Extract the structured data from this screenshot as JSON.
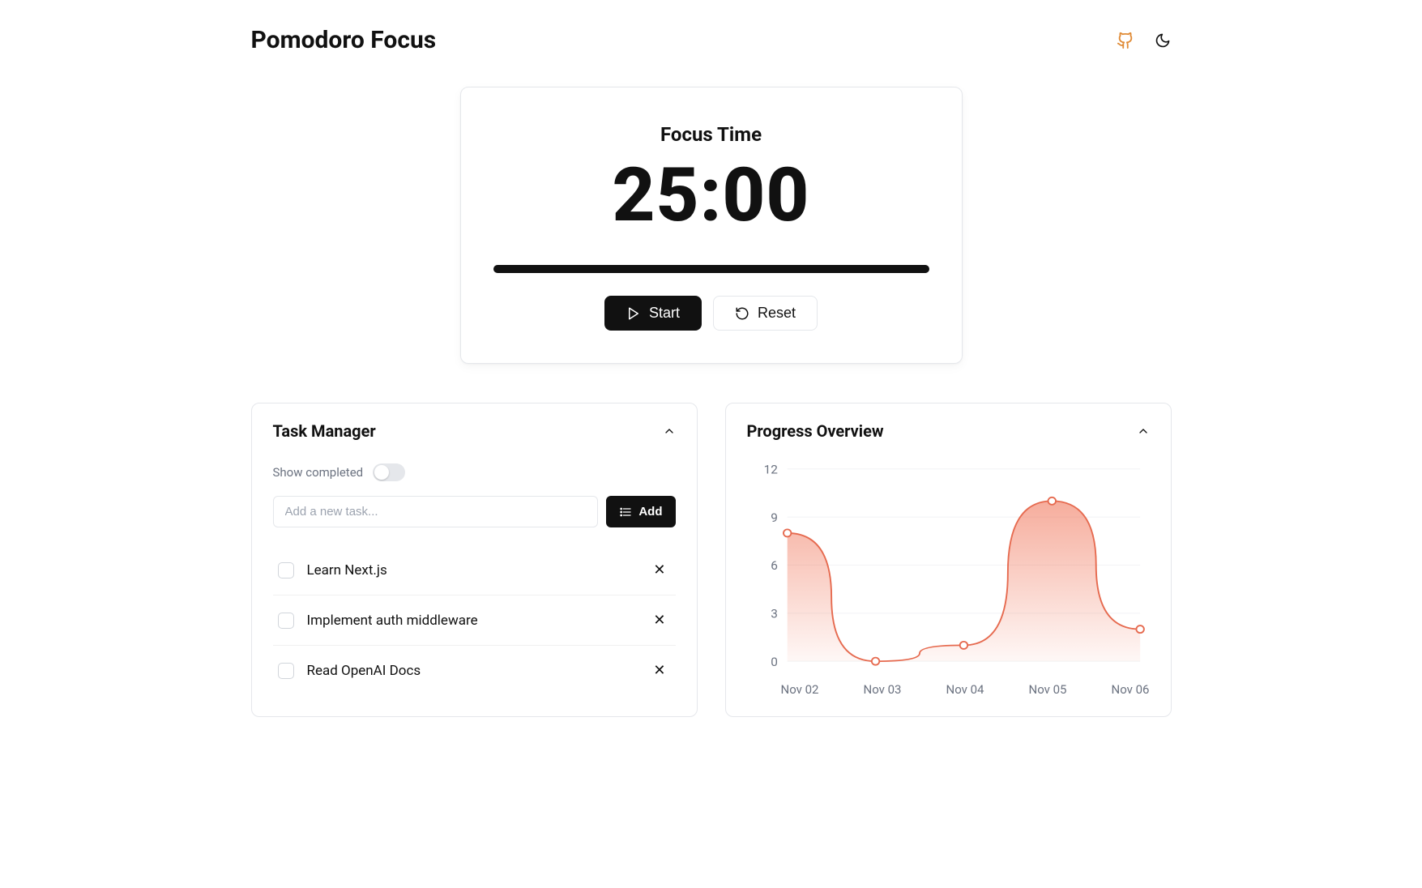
{
  "header": {
    "title": "Pomodoro Focus"
  },
  "timer": {
    "label": "Focus Time",
    "value": "25:00",
    "start_label": "Start",
    "reset_label": "Reset"
  },
  "task_panel": {
    "title": "Task Manager",
    "show_completed_label": "Show completed",
    "input_placeholder": "Add a new task...",
    "add_label": "Add",
    "tasks": [
      {
        "label": "Learn Next.js"
      },
      {
        "label": "Implement auth middleware"
      },
      {
        "label": "Read OpenAI Docs"
      }
    ]
  },
  "progress_panel": {
    "title": "Progress Overview"
  },
  "chart_data": {
    "type": "area",
    "categories": [
      "Nov 02",
      "Nov 03",
      "Nov 04",
      "Nov 05",
      "Nov 06"
    ],
    "values": [
      8,
      0,
      1,
      10,
      2
    ],
    "ylim": [
      0,
      12
    ],
    "y_ticks": [
      0,
      3,
      6,
      9,
      12
    ],
    "xlabel": "",
    "ylabel": "",
    "title": ""
  }
}
